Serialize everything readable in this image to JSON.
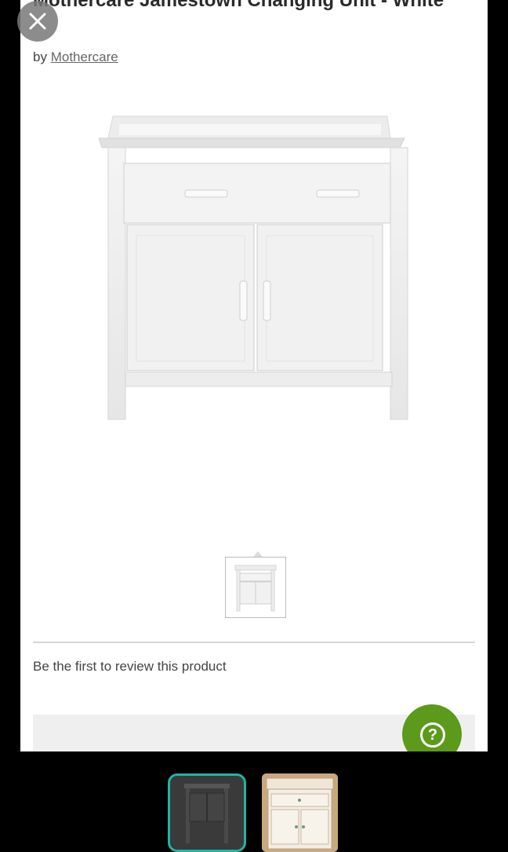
{
  "product": {
    "title": "Mothercare Jamestown Changing Unit - White",
    "by_prefix": "by",
    "brand": "Mothercare"
  },
  "reviews": {
    "empty_text": "Be the first to review this product"
  },
  "help": {
    "icon": "help-icon",
    "glyph": "?",
    "color": "#5c9a1b"
  },
  "overlay": {
    "close_icon": "close-icon"
  },
  "gallery": {
    "active_border_color": "#1fb5a6",
    "count": 2
  }
}
